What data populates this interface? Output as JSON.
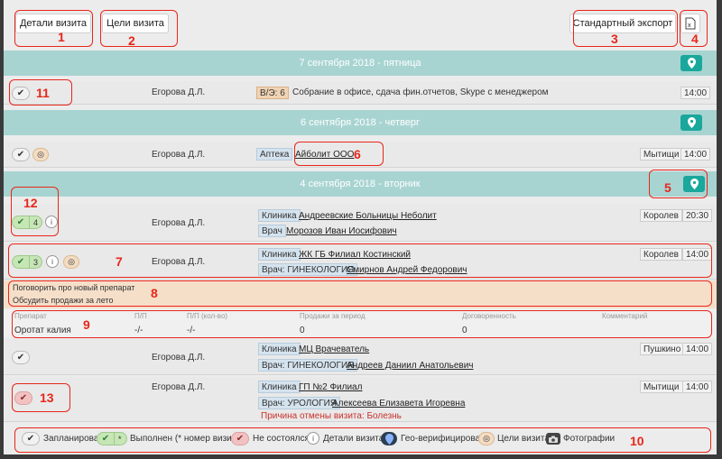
{
  "toolbar": {
    "details_btn": "Детали визита",
    "goals_btn": "Цели визита",
    "export_btn": "Стандартный экспорт",
    "excel_icon": "excel-icon"
  },
  "annotations": [
    "1",
    "2",
    "3",
    "4",
    "5",
    "6",
    "7",
    "8",
    "9",
    "10",
    "11",
    "12",
    "13"
  ],
  "dates": [
    "7 сентября 2018 - пятница",
    "6 сентября 2018 - четверг",
    "4 сентября 2018 - вторник"
  ],
  "visits": [
    {
      "agent": "Егорова Д.Л.",
      "tag": "В/Э: 6",
      "title": "Собрание в офисе, сдача фин.отчетов, Skype с менеджером",
      "time": "14:00"
    },
    {
      "agent": "Егорова Д.Л.",
      "tag": "Аптека",
      "title": "Айболит ООО",
      "city": "Мытищи",
      "time": "14:00"
    },
    {
      "agent": "Егорова Д.Л.",
      "count": "4",
      "tag": "Клиника",
      "title": "Андреевские Больницы Неболит",
      "doctor_label": "Врач",
      "doctor": "Морозов Иван Иосифович",
      "city": "Королев",
      "time": "20:30"
    },
    {
      "agent": "Егорова Д.Л.",
      "count": "3",
      "tag": "Клиника",
      "title": "ЖК ГБ Филиал Костинский",
      "doctor_label": "Врач: ГИНЕКОЛОГИЯ",
      "doctor": "Смирнов Андрей Федорович",
      "city": "Королев",
      "time": "14:00"
    },
    {
      "agent": "Егорова Д.Л.",
      "tag": "Клиника",
      "title": "МЦ Врачеватель",
      "doctor_label": "Врач: ГИНЕКОЛОГИЯ",
      "doctor": "Андреев Даниил Анатольевич",
      "city": "Пушкино",
      "time": "14:00"
    },
    {
      "agent": "Егорова Д.Л.",
      "tag": "Клиника",
      "title": "ГП №2 Филиал",
      "doctor_label": "Врач: УРОЛОГИЯ",
      "doctor": "Алексеева Елизавета Игоревна",
      "cancel_reason": "Причина отмены визита: Болезнь",
      "city": "Мытищи",
      "time": "14:00"
    }
  ],
  "goals": [
    "Поговорить про новый препарат",
    "Обсудить продажи за лето"
  ],
  "table": {
    "headers": [
      "Препарат",
      "П/П",
      "П/П (кол-во)",
      "Продажи за период",
      "Договоренность",
      "Комментарий"
    ],
    "row": [
      "Оротат калия",
      "-/-",
      "-/-",
      "0",
      "0",
      ""
    ]
  },
  "legend": {
    "planned": "Запланирован",
    "done_marker": "*",
    "done": "Выполнен (* номер визита)",
    "failed": "Не состоялся",
    "details": "Детали визита",
    "geo": "Гео-верифицирован",
    "goals": "Цели визита",
    "photos": "Фотографии"
  },
  "colors": {
    "teal": "#1aa79c",
    "date_band": "#a7d4d1",
    "annotation": "#e8261a"
  }
}
